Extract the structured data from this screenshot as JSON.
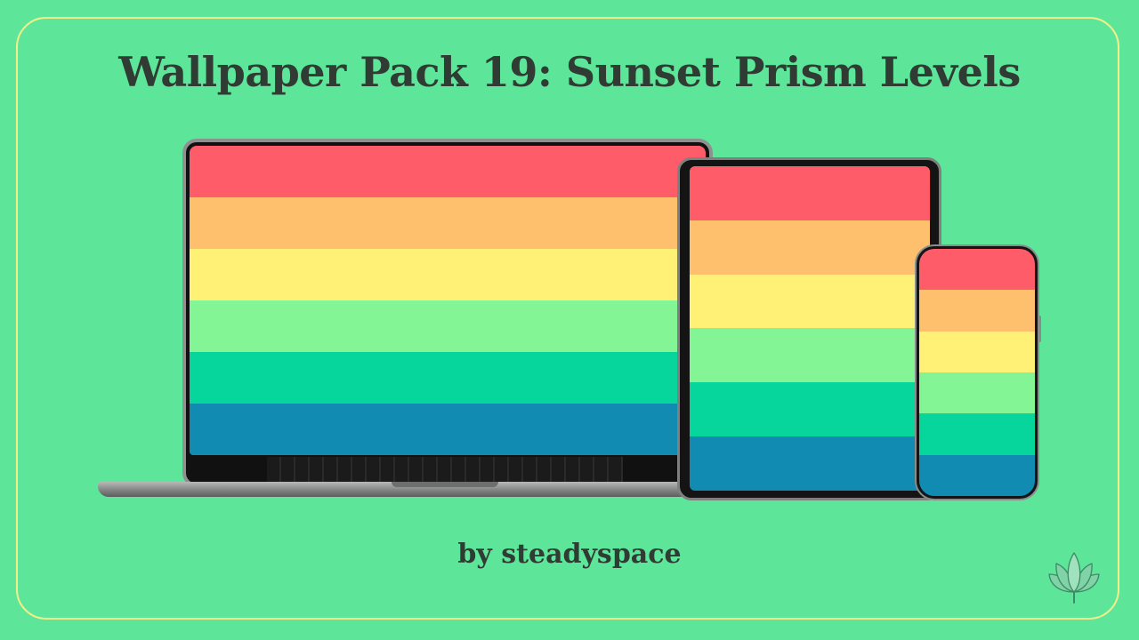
{
  "colors": {
    "background": "#5de69a",
    "frame": "#f3f08a",
    "text": "#2f3b33",
    "stripes": [
      "#ff5c6a",
      "#ffc06e",
      "#fff176",
      "#84f594",
      "#06d69c",
      "#128bb2"
    ]
  },
  "header": {
    "title": "Wallpaper Pack 19: Sunset Prism Levels"
  },
  "footer": {
    "byline": "by steadyspace"
  },
  "icons": {
    "logo": "lotus-icon"
  }
}
